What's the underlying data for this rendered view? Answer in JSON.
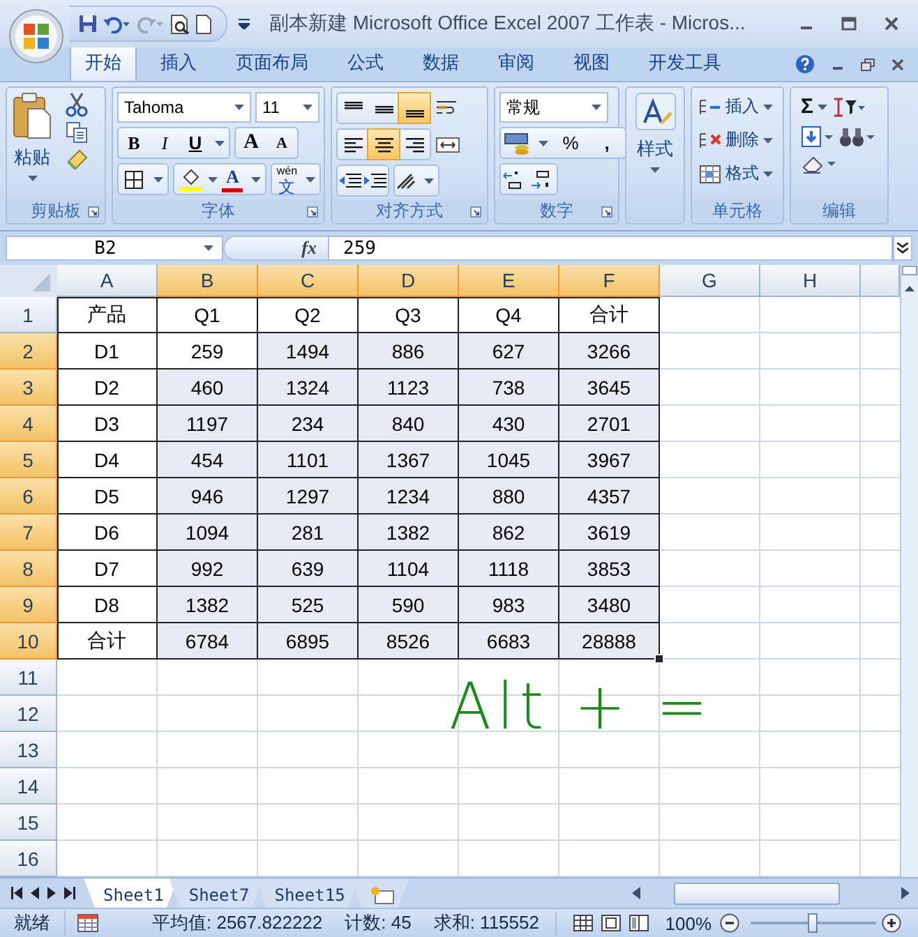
{
  "title_bar": {
    "title": "副本新建 Microsoft Office Excel 2007 工作表 - Micros..."
  },
  "ribbon_tabs": [
    {
      "label": "开始",
      "selected": true
    },
    {
      "label": "插入",
      "selected": false
    },
    {
      "label": "页面布局",
      "selected": false
    },
    {
      "label": "公式",
      "selected": false
    },
    {
      "label": "数据",
      "selected": false
    },
    {
      "label": "审阅",
      "selected": false
    },
    {
      "label": "视图",
      "selected": false
    },
    {
      "label": "开发工具",
      "selected": false
    }
  ],
  "ribbon": {
    "clipboard": {
      "label": "剪贴板",
      "paste": "粘贴"
    },
    "font": {
      "label": "字体",
      "font_name": "Tahoma",
      "font_size": "11",
      "bold": "B",
      "italic": "I",
      "underline": "U",
      "grow": "A",
      "shrink": "A",
      "font_color": "A",
      "phonetic": "wén",
      "phonetic_char": "文"
    },
    "alignment": {
      "label": "对齐方式",
      "vertical": [
        {
          "kind": "top",
          "selected": false
        },
        {
          "kind": "middle",
          "selected": false
        },
        {
          "kind": "bottom",
          "selected": true
        }
      ],
      "horizontal": [
        {
          "kind": "left",
          "selected": false
        },
        {
          "kind": "center",
          "selected": true
        },
        {
          "kind": "right",
          "selected": false
        }
      ]
    },
    "number": {
      "label": "数字",
      "format": "常规",
      "percent": "%",
      "comma": ","
    },
    "styles": {
      "button": "样式"
    },
    "cells": {
      "label": "单元格",
      "buttons": [
        {
          "kind": "insert",
          "label": "插入"
        },
        {
          "kind": "delete",
          "label": "删除"
        },
        {
          "kind": "format",
          "label": "格式"
        }
      ]
    },
    "editing": {
      "label": "编辑",
      "sum": "Σ"
    }
  },
  "formula_bar": {
    "name_box": "B2",
    "function_label": "fx",
    "value": "259"
  },
  "sheet": {
    "columns": [
      {
        "label": "A",
        "selected": false
      },
      {
        "label": "B",
        "selected": true
      },
      {
        "label": "C",
        "selected": true
      },
      {
        "label": "D",
        "selected": true
      },
      {
        "label": "E",
        "selected": true
      },
      {
        "label": "F",
        "selected": true
      },
      {
        "label": "G",
        "selected": false
      },
      {
        "label": "H",
        "selected": false
      }
    ],
    "rows": [
      {
        "label": "1",
        "selected": false,
        "cells": [
          "产品",
          "Q1",
          "Q2",
          "Q3",
          "Q4",
          "合计"
        ]
      },
      {
        "label": "2",
        "selected": true,
        "cells": [
          "D1",
          "259",
          "1494",
          "886",
          "627",
          "3266"
        ]
      },
      {
        "label": "3",
        "selected": true,
        "cells": [
          "D2",
          "460",
          "1324",
          "1123",
          "738",
          "3645"
        ]
      },
      {
        "label": "4",
        "selected": true,
        "cells": [
          "D3",
          "1197",
          "234",
          "840",
          "430",
          "2701"
        ]
      },
      {
        "label": "5",
        "selected": true,
        "cells": [
          "D4",
          "454",
          "1101",
          "1367",
          "1045",
          "3967"
        ]
      },
      {
        "label": "6",
        "selected": true,
        "cells": [
          "D5",
          "946",
          "1297",
          "1234",
          "880",
          "4357"
        ]
      },
      {
        "label": "7",
        "selected": true,
        "cells": [
          "D6",
          "1094",
          "281",
          "1382",
          "862",
          "3619"
        ]
      },
      {
        "label": "8",
        "selected": true,
        "cells": [
          "D7",
          "992",
          "639",
          "1104",
          "1118",
          "3853"
        ]
      },
      {
        "label": "9",
        "selected": true,
        "cells": [
          "D8",
          "1382",
          "525",
          "590",
          "983",
          "3480"
        ]
      },
      {
        "label": "10",
        "selected": true,
        "cells": [
          "合计",
          "6784",
          "6895",
          "8526",
          "6683",
          "28888"
        ]
      },
      {
        "label": "11",
        "selected": false
      },
      {
        "label": "12",
        "selected": false
      },
      {
        "label": "13",
        "selected": false
      },
      {
        "label": "14",
        "selected": false
      },
      {
        "label": "15",
        "selected": false
      },
      {
        "label": "16",
        "selected": false
      }
    ],
    "annotation": "Alt + ="
  },
  "sheet_tabs": [
    {
      "label": "Sheet1",
      "selected": true
    },
    {
      "label": "Sheet7",
      "selected": false
    },
    {
      "label": "Sheet15",
      "selected": false
    }
  ],
  "status_bar": {
    "mode": "就绪",
    "average": "平均值: 2567.822222",
    "count": "计数: 45",
    "sum": "求和: 115552",
    "zoom": "100%",
    "zoom_slider": {
      "level": 0.5
    }
  }
}
